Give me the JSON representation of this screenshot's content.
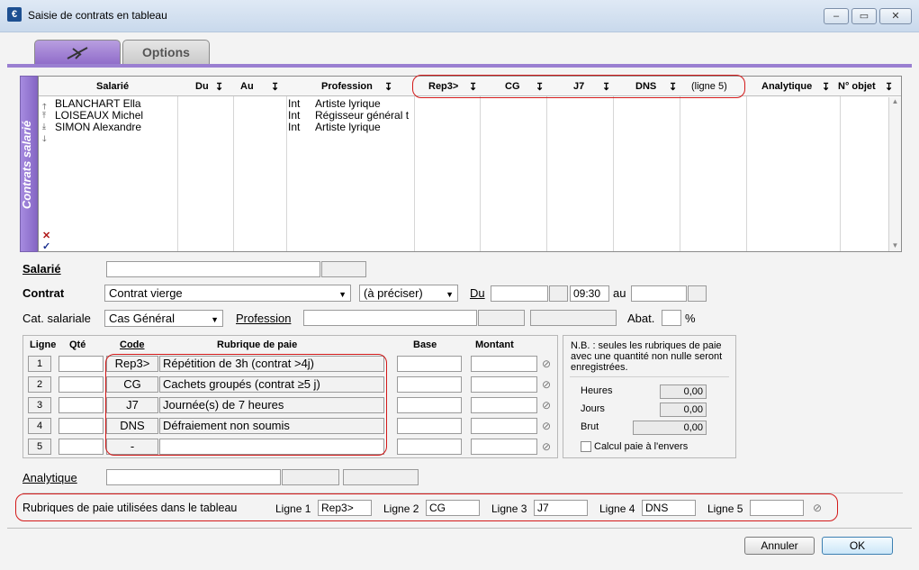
{
  "window": {
    "title": "Saisie de contrats en tableau",
    "minimize": "–",
    "maximize": "▭",
    "close": "✕"
  },
  "tabs": [
    {
      "label": "",
      "icon": "plane-icon"
    },
    {
      "label": "Options"
    }
  ],
  "grid": {
    "side_label": "Contrats salarié",
    "columns": {
      "salarie": "Salarié",
      "du": "Du",
      "au": "Au",
      "profession": "Profession",
      "rep3": "Rep3>",
      "cg": "CG",
      "j7": "J7",
      "dns": "DNS",
      "ligne5": "(ligne 5)",
      "analytique": "Analytique",
      "nobjet": "N° objet"
    },
    "rows": [
      {
        "salarie": "BLANCHART Ella",
        "type": "Int",
        "profession": "Artiste lyrique"
      },
      {
        "salarie": "LOISEAUX Michel",
        "type": "Int",
        "profession": "Régisseur général t"
      },
      {
        "salarie": "SIMON Alexandre",
        "type": "Int",
        "profession": "Artiste lyrique"
      }
    ]
  },
  "form": {
    "salarie_label": "Salarié",
    "contrat_label": "Contrat",
    "contrat_value": "Contrat vierge",
    "contrat_type": "(à préciser)",
    "du_label": "Du",
    "time_value": "09:30",
    "au_label": "au",
    "cat_label": "Cat. salariale",
    "cat_value": "Cas Général",
    "profession_label": "Profession",
    "abat_label": "Abat.",
    "percent": "%"
  },
  "lines_table": {
    "headers": {
      "ligne": "Ligne",
      "qte": "Qté",
      "code": "Code",
      "rubrique": "Rubrique de paie",
      "base": "Base",
      "montant": "Montant"
    },
    "rows": [
      {
        "num": "1",
        "code": "Rep3>",
        "rubrique": "Répétition de 3h (contrat >4j)"
      },
      {
        "num": "2",
        "code": "CG",
        "rubrique": "Cachets groupés (contrat ≥5 j)"
      },
      {
        "num": "3",
        "code": "J7",
        "rubrique": "Journée(s) de 7 heures"
      },
      {
        "num": "4",
        "code": "DNS",
        "rubrique": "Défraiement non soumis"
      },
      {
        "num": "5",
        "code": "-",
        "rubrique": ""
      }
    ]
  },
  "nb_panel": {
    "note": "N.B. : seules les rubriques de paie avec une quantité non nulle seront enregistrées.",
    "heures_label": "Heures",
    "heures_value": "0,00",
    "jours_label": "Jours",
    "jours_value": "0,00",
    "brut_label": "Brut",
    "brut_value": "0,00",
    "calcul_label": "Calcul paie à l'envers"
  },
  "analytique_label": "Analytique",
  "rubriques_bar": {
    "label": "Rubriques de paie utilisées dans le tableau",
    "l1_label": "Ligne 1",
    "l1_value": "Rep3>",
    "l2_label": "Ligne 2",
    "l2_value": "CG",
    "l3_label": "Ligne 3",
    "l3_value": "J7",
    "l4_label": "Ligne 4",
    "l4_value": "DNS",
    "l5_label": "Ligne 5",
    "l5_value": ""
  },
  "buttons": {
    "annuler": "Annuler",
    "ok": "OK"
  },
  "colors": {
    "accent": "#9a7fd1",
    "highlight": "#d31919"
  }
}
